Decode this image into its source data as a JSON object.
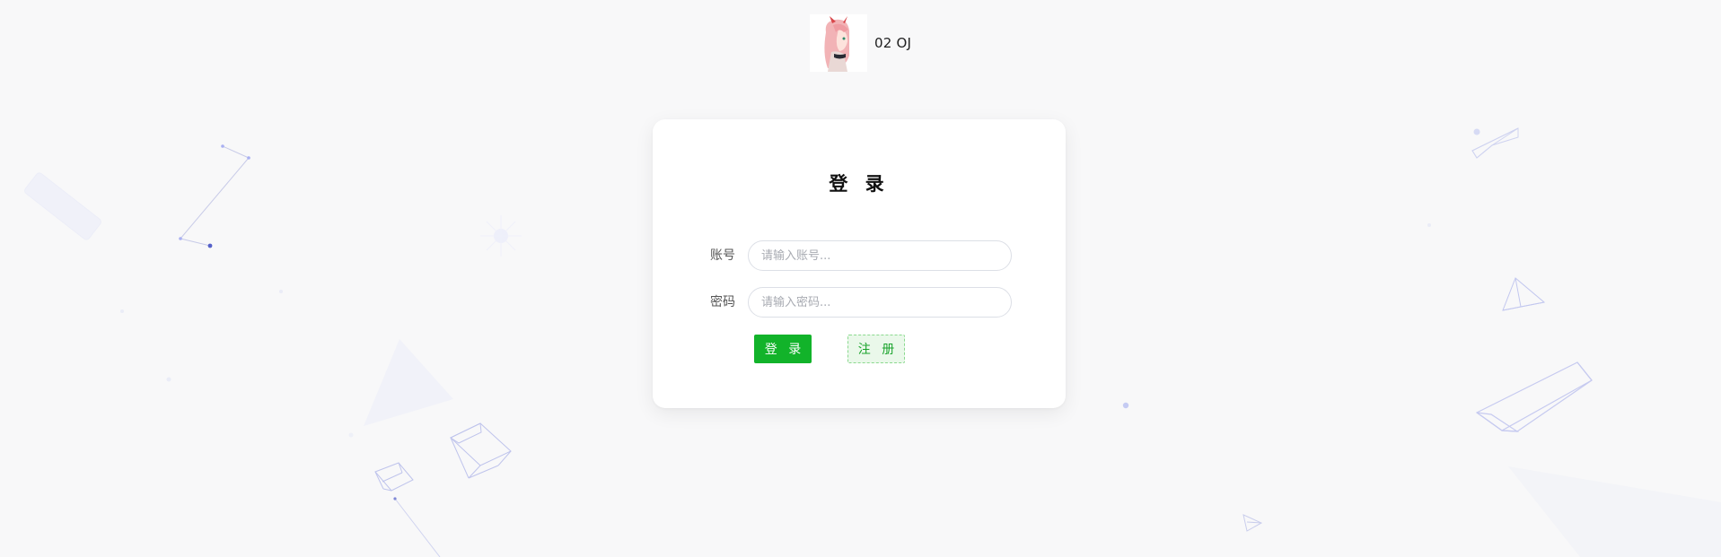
{
  "brand": {
    "name": "02 OJ",
    "logo_icon": "avatar-image"
  },
  "login": {
    "title": "登 录",
    "account": {
      "label": "账号",
      "placeholder": "请输入账号...",
      "value": ""
    },
    "password": {
      "label": "密码",
      "placeholder": "请输入密码...",
      "value": ""
    },
    "login_button": "登 录",
    "register_button": "注 册"
  },
  "colors": {
    "accent": "#12b32a",
    "background": "#f8f8f9",
    "card": "#ffffff",
    "decoration": "#c9cdf3"
  }
}
